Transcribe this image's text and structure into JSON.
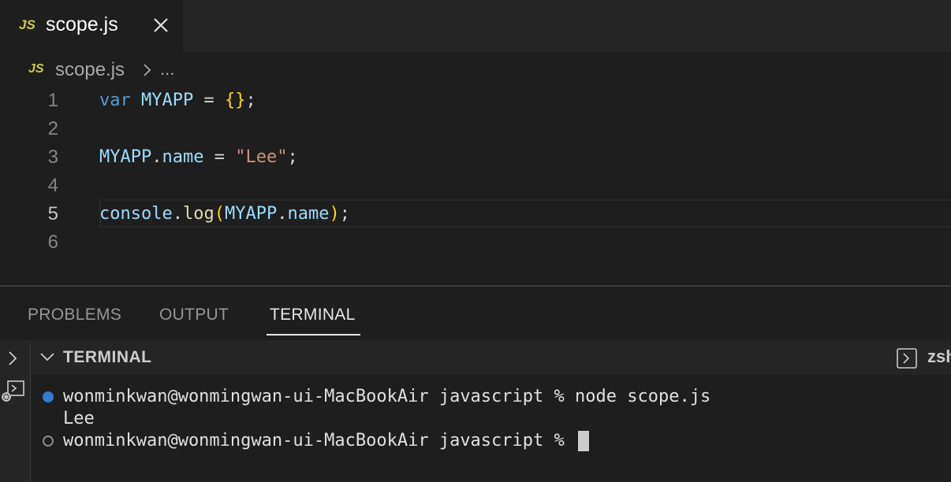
{
  "tabs": [
    {
      "badge": "JS",
      "label": "scope.js"
    }
  ],
  "breadcrumb": {
    "badge": "JS",
    "file": "scope.js",
    "more": "..."
  },
  "editor": {
    "lines": [
      {
        "num": "1"
      },
      {
        "num": "2"
      },
      {
        "num": "3"
      },
      {
        "num": "4"
      },
      {
        "num": "5"
      },
      {
        "num": "6"
      }
    ],
    "code": {
      "l1_kw": "var",
      "l1_var": "MYAPP",
      "l1_op": " = ",
      "l1_brace": "{}",
      "l1_end": ";",
      "l3_obj": "MYAPP",
      "l3_dot": ".",
      "l3_prop": "name",
      "l3_op": " = ",
      "l3_str": "\"Lee\"",
      "l3_end": ";",
      "l5_obj": "console",
      "l5_dot": ".",
      "l5_fn": "log",
      "l5_open": "(",
      "l5_arg_obj": "MYAPP",
      "l5_arg_dot": ".",
      "l5_arg_prop": "name",
      "l5_close": ")",
      "l5_end": ";"
    }
  },
  "panel": {
    "tabs": [
      "PROBLEMS",
      "OUTPUT",
      "TERMINAL"
    ],
    "active_tab": "TERMINAL"
  },
  "terminal": {
    "title": "TERMINAL",
    "shell": "zsh",
    "lines": [
      "wonminkwan@wonmingwan-ui-MacBookAir javascript % node scope.js",
      "Lee",
      "wonminkwan@wonmingwan-ui-MacBookAir javascript % "
    ]
  },
  "colors": {
    "accent": "#3794ff",
    "js_badge": "#cbcb41",
    "keyword": "#569cd6",
    "variable": "#9cdcfe",
    "string": "#ce9178",
    "function": "#dcdcaa"
  }
}
